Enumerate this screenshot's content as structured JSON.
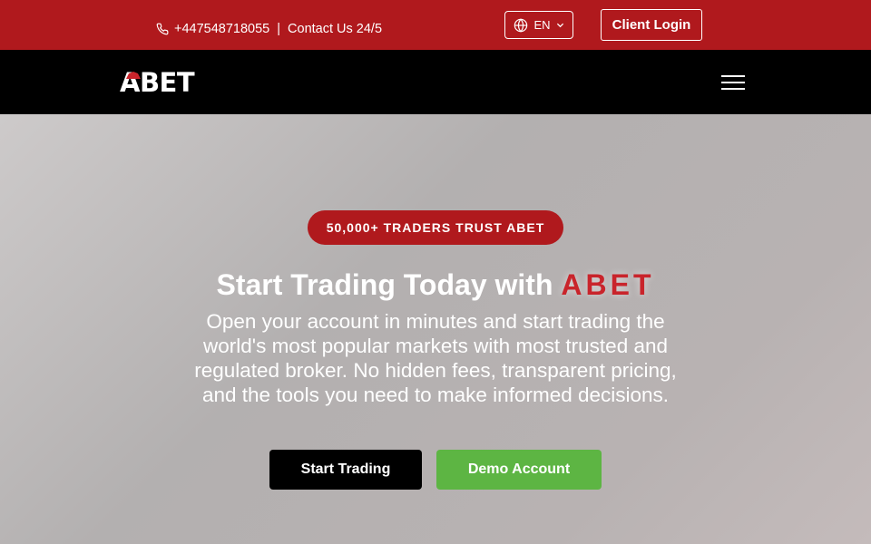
{
  "topbar": {
    "phone": "+447548718055",
    "separator": "|",
    "contact_label": "Contact Us 24/5",
    "language": "EN",
    "login_label": "Client Login"
  },
  "navbar": {
    "logo_text": "ABET"
  },
  "hero": {
    "badge": "50,000+ TRADERS TRUST ABET",
    "headline_prefix": "Start Trading Today with",
    "headline_brand": "ABET",
    "subtext": "Open your account in minutes and start trading the world's most popular markets with most trusted and regulated broker. No hidden fees, transparent pricing, and the tools you need to make informed decisions.",
    "primary_cta": "Start Trading",
    "secondary_cta": "Demo Account"
  },
  "colors": {
    "brand_red": "#b0191d",
    "nav_black": "#000000",
    "demo_green": "#5db543"
  },
  "icons": {
    "phone": "phone-icon",
    "globe": "globe-icon",
    "chevron": "chevron-down-icon",
    "menu": "hamburger-menu-icon"
  }
}
